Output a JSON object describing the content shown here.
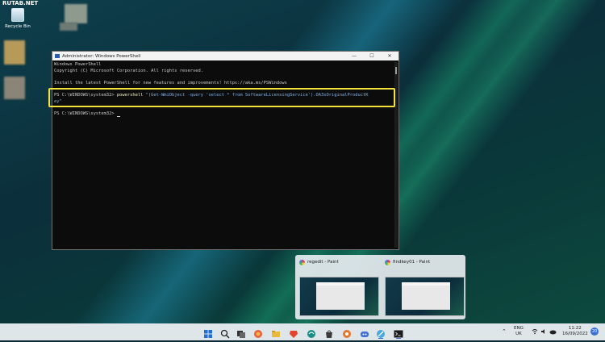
{
  "watermark": "RUTAB.NET",
  "desktop": {
    "recycle_bin_label": "Recycle Bin"
  },
  "powershell": {
    "window_title": "Administrator: Windows PowerShell",
    "controls": {
      "minimize": "—",
      "maximize": "☐",
      "close": "✕"
    },
    "lines": {
      "l1": "Windows PowerShell",
      "l2": "Copyright (C) Microsoft Corporation. All rights reserved.",
      "l3": "Install the latest PowerShell for new features and improvements! https://aka.ms/PSWindows",
      "prompt1": "PS C:\\WINDOWS\\system32> ",
      "cmd_keyword": "powershell ",
      "cmd_arg": "\"(Get-WmiObject -query 'select * from SoftwareLicensingService').OA3xOriginalProductK",
      "cmd_wrap": "ey\"",
      "prompt2": "PS C:\\WINDOWS\\system32> "
    }
  },
  "taskbar_thumbnails": [
    {
      "title": "regedit - Paint"
    },
    {
      "title": "findkey01 - Paint"
    }
  ],
  "taskbar": {
    "icons": [
      {
        "name": "start-icon",
        "color": "#1f6fd6"
      },
      {
        "name": "search-icon",
        "color": "#333333"
      },
      {
        "name": "task-view-icon",
        "color": "#333333"
      },
      {
        "name": "widgets-icon",
        "color": "#e8603c"
      },
      {
        "name": "file-explorer-icon",
        "color": "#e9b93a"
      },
      {
        "name": "brave-icon",
        "color": "#e2452b"
      },
      {
        "name": "edge-icon",
        "color": "#1c8e8a"
      },
      {
        "name": "store-icon",
        "color": "#3b3b3b"
      },
      {
        "name": "steam-icon",
        "color": "#1b3b5c"
      },
      {
        "name": "settings-icon",
        "color": "#d9731e"
      },
      {
        "name": "discord-icon",
        "color": "#3f6fd6"
      },
      {
        "name": "paint-icon",
        "color": "#4aa8e0"
      },
      {
        "name": "terminal-icon",
        "color": "#1a1a1a"
      }
    ],
    "tray": {
      "language_top": "ENG",
      "language_bottom": "UK",
      "time": "11:22",
      "date": "16/09/2022",
      "notification_count": "20"
    }
  }
}
